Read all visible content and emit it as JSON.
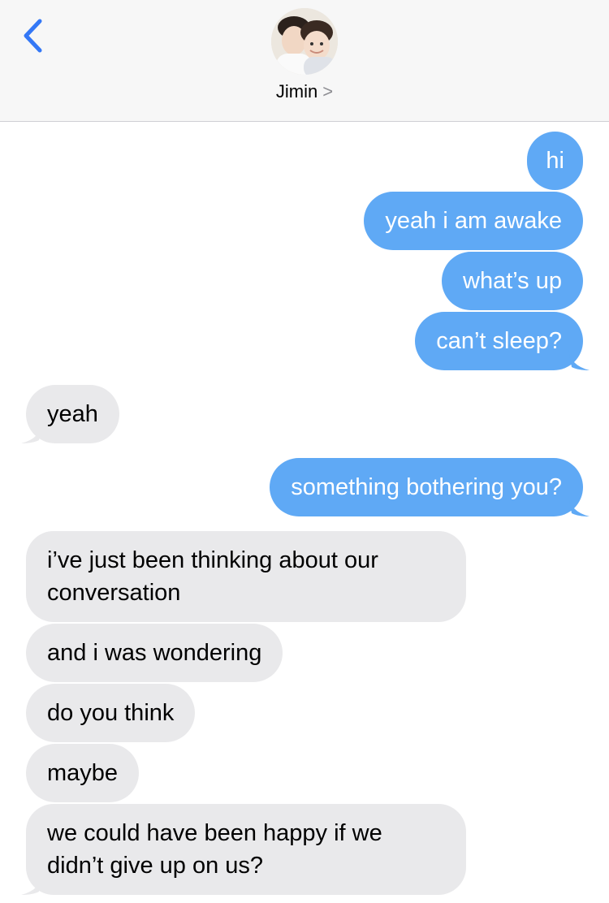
{
  "header": {
    "contact_name": "Jimin",
    "contact_chevron": ">",
    "back_icon": "chevron-left-icon",
    "accent_color": "#3478f6",
    "header_bg": "#f7f7f7"
  },
  "colors": {
    "outgoing_bubble": "#5fa9f5",
    "incoming_bubble": "#e9e9eb"
  },
  "messages": [
    {
      "direction": "outgoing",
      "text": "hi"
    },
    {
      "direction": "outgoing",
      "text": "yeah i am awake"
    },
    {
      "direction": "outgoing",
      "text": "what’s up"
    },
    {
      "direction": "outgoing",
      "text": "can’t sleep?"
    },
    {
      "direction": "incoming",
      "text": "yeah"
    },
    {
      "direction": "outgoing",
      "text": "something bothering you?"
    },
    {
      "direction": "incoming",
      "text": "i’ve just been thinking about our conversation"
    },
    {
      "direction": "incoming",
      "text": "and i was wondering"
    },
    {
      "direction": "incoming",
      "text": "do you think"
    },
    {
      "direction": "incoming",
      "text": "maybe"
    },
    {
      "direction": "incoming",
      "text": "we could have been happy if we didn’t give up on us?"
    }
  ]
}
